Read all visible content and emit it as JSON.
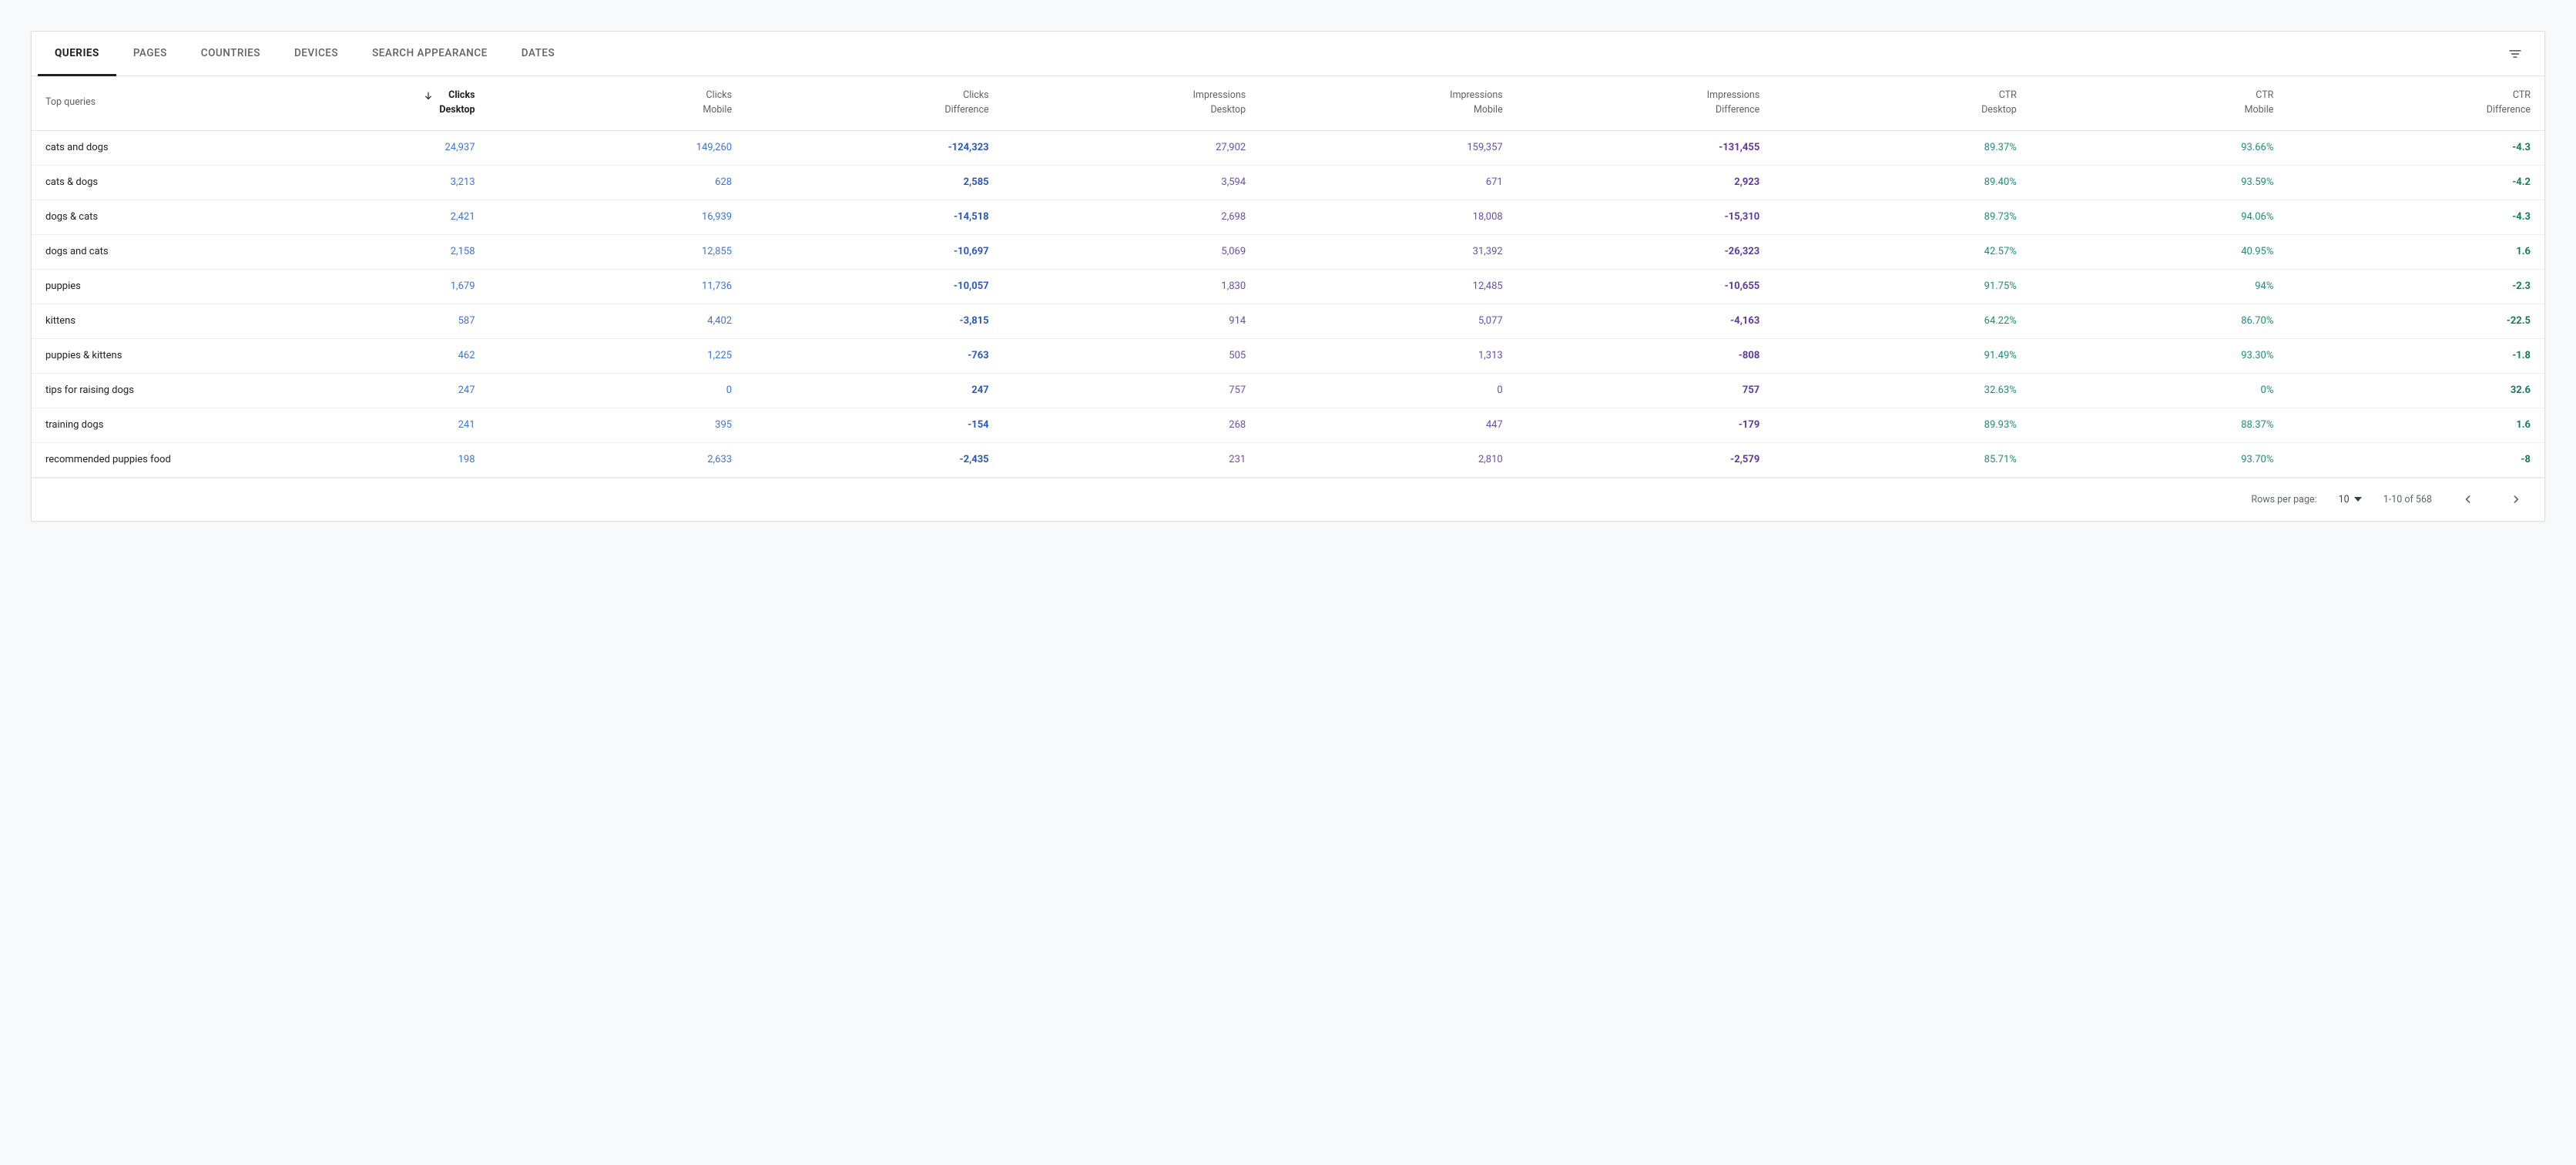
{
  "tabs": [
    {
      "label": "QUERIES",
      "active": true
    },
    {
      "label": "PAGES",
      "active": false
    },
    {
      "label": "COUNTRIES",
      "active": false
    },
    {
      "label": "DEVICES",
      "active": false
    },
    {
      "label": "SEARCH APPEARANCE",
      "active": false
    },
    {
      "label": "DATES",
      "active": false
    }
  ],
  "table": {
    "primary_header": "Top queries",
    "columns": [
      {
        "line1": "Clicks",
        "line2": "Desktop",
        "group": "clicks",
        "diff": false,
        "sorted": true
      },
      {
        "line1": "Clicks",
        "line2": "Mobile",
        "group": "clicks",
        "diff": false
      },
      {
        "line1": "Clicks",
        "line2": "Difference",
        "group": "clicks",
        "diff": true
      },
      {
        "line1": "Impressions",
        "line2": "Desktop",
        "group": "impr",
        "diff": false
      },
      {
        "line1": "Impressions",
        "line2": "Mobile",
        "group": "impr",
        "diff": false
      },
      {
        "line1": "Impressions",
        "line2": "Difference",
        "group": "impr",
        "diff": true
      },
      {
        "line1": "CTR",
        "line2": "Desktop",
        "group": "ctr",
        "diff": false
      },
      {
        "line1": "CTR",
        "line2": "Mobile",
        "group": "ctr",
        "diff": false
      },
      {
        "line1": "CTR",
        "line2": "Difference",
        "group": "ctr",
        "diff": true
      }
    ],
    "rows": [
      {
        "query": "cats and dogs",
        "cells": [
          "24,937",
          "149,260",
          "-124,323",
          "27,902",
          "159,357",
          "-131,455",
          "89.37%",
          "93.66%",
          "-4.3"
        ]
      },
      {
        "query": "cats & dogs",
        "cells": [
          "3,213",
          "628",
          "2,585",
          "3,594",
          "671",
          "2,923",
          "89.40%",
          "93.59%",
          "-4.2"
        ]
      },
      {
        "query": "dogs & cats",
        "cells": [
          "2,421",
          "16,939",
          "-14,518",
          "2,698",
          "18,008",
          "-15,310",
          "89.73%",
          "94.06%",
          "-4.3"
        ]
      },
      {
        "query": "dogs and cats",
        "cells": [
          "2,158",
          "12,855",
          "-10,697",
          "5,069",
          "31,392",
          "-26,323",
          "42.57%",
          "40.95%",
          "1.6"
        ]
      },
      {
        "query": "puppies",
        "cells": [
          "1,679",
          "11,736",
          "-10,057",
          "1,830",
          "12,485",
          "-10,655",
          "91.75%",
          "94%",
          "-2.3"
        ]
      },
      {
        "query": "kittens",
        "cells": [
          "587",
          "4,402",
          "-3,815",
          "914",
          "5,077",
          "-4,163",
          "64.22%",
          "86.70%",
          "-22.5"
        ]
      },
      {
        "query": "puppies & kittens",
        "cells": [
          "462",
          "1,225",
          "-763",
          "505",
          "1,313",
          "-808",
          "91.49%",
          "93.30%",
          "-1.8"
        ]
      },
      {
        "query": "tips for raising dogs",
        "cells": [
          "247",
          "0",
          "247",
          "757",
          "0",
          "757",
          "32.63%",
          "0%",
          "32.6"
        ]
      },
      {
        "query": "training dogs",
        "cells": [
          "241",
          "395",
          "-154",
          "268",
          "447",
          "-179",
          "89.93%",
          "88.37%",
          "1.6"
        ]
      },
      {
        "query": "recommended puppies food",
        "cells": [
          "198",
          "2,633",
          "-2,435",
          "231",
          "2,810",
          "-2,579",
          "85.71%",
          "93.70%",
          "-8"
        ]
      }
    ]
  },
  "pager": {
    "rows_label": "Rows per page:",
    "rows_value": "10",
    "range": "1-10 of 568"
  }
}
